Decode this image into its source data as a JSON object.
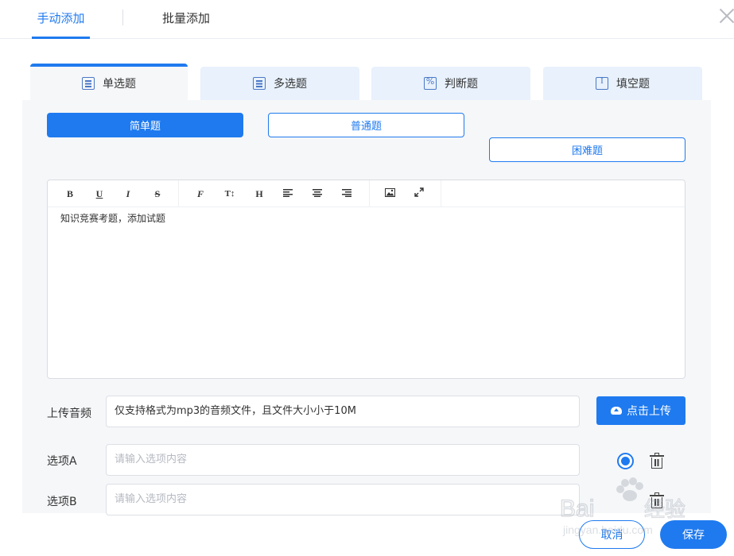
{
  "top_tabs": {
    "manual": "手动添加",
    "batch": "批量添加"
  },
  "question_types": [
    {
      "label": "单选题",
      "icon": "list-icon",
      "active": true
    },
    {
      "label": "多选题",
      "icon": "list-icon",
      "active": false
    },
    {
      "label": "判断题",
      "icon": "percent-icon",
      "active": false
    },
    {
      "label": "填空题",
      "icon": "text-cursor-icon",
      "active": false
    }
  ],
  "difficulty": {
    "easy": "简单题",
    "normal": "普通题",
    "hard": "困难题",
    "selected": "简单题"
  },
  "editor": {
    "toolbar": [
      "B",
      "U",
      "I",
      "S",
      "F",
      "T↕",
      "H",
      "align-left",
      "align-center",
      "align-right",
      "image",
      "fullscreen"
    ],
    "content": "知识竞赛考题，添加试题"
  },
  "audio": {
    "label": "上传音频",
    "hint": "仅支持格式为mp3的音频文件，且文件大小小于10M",
    "upload_label": "点击上传"
  },
  "options": [
    {
      "label": "选项A",
      "placeholder": "请输入选项内容",
      "correct": true
    },
    {
      "label": "选项B",
      "placeholder": "请输入选项内容",
      "correct": false
    }
  ],
  "footer": {
    "cancel": "取消",
    "save": "保存"
  },
  "watermark": "Baidu 经验 jingyan.baidu.com",
  "colors": {
    "accent": "#1f7aef",
    "tab_bg": "#e8f1fc",
    "panel_bg": "#f6f7f9"
  }
}
